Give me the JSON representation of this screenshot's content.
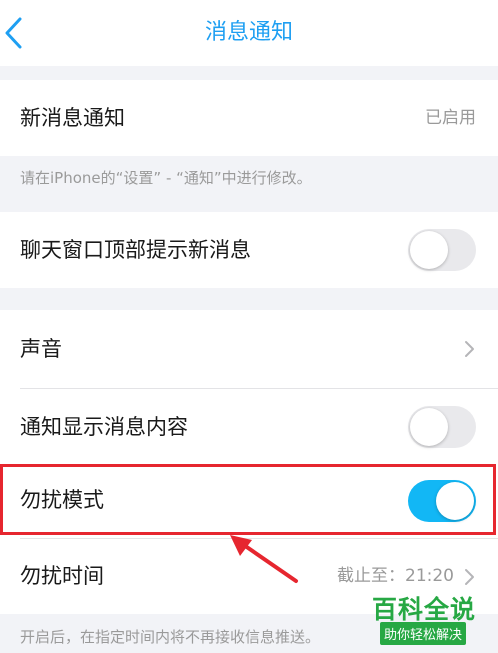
{
  "nav": {
    "title": "消息通知",
    "back_icon": "chevron-left-icon"
  },
  "new_message": {
    "label": "新消息通知",
    "value": "已启用"
  },
  "new_message_note": "请在iPhone的“设置” - “通知”中进行修改。",
  "top_banner": {
    "label": "聊天窗口顶部提示新消息",
    "enabled": false
  },
  "sound": {
    "label": "声音",
    "icon": "chevron-right-icon"
  },
  "show_content": {
    "label": "通知显示消息内容",
    "enabled": false
  },
  "dnd_mode": {
    "label": "勿扰模式",
    "enabled": true
  },
  "dnd_time": {
    "label": "勿扰时间",
    "value": "截止至：21:20",
    "icon": "chevron-right-icon"
  },
  "dnd_note": "开启后，在指定时间内将不再接收信息推送。",
  "watermark": {
    "line1": "百科全说",
    "line2": "助你轻松解决"
  },
  "colors": {
    "accent": "#1e9ff2",
    "toggle_on": "#12b7f5",
    "highlight": "#e6262f",
    "watermark": "#27a844"
  }
}
